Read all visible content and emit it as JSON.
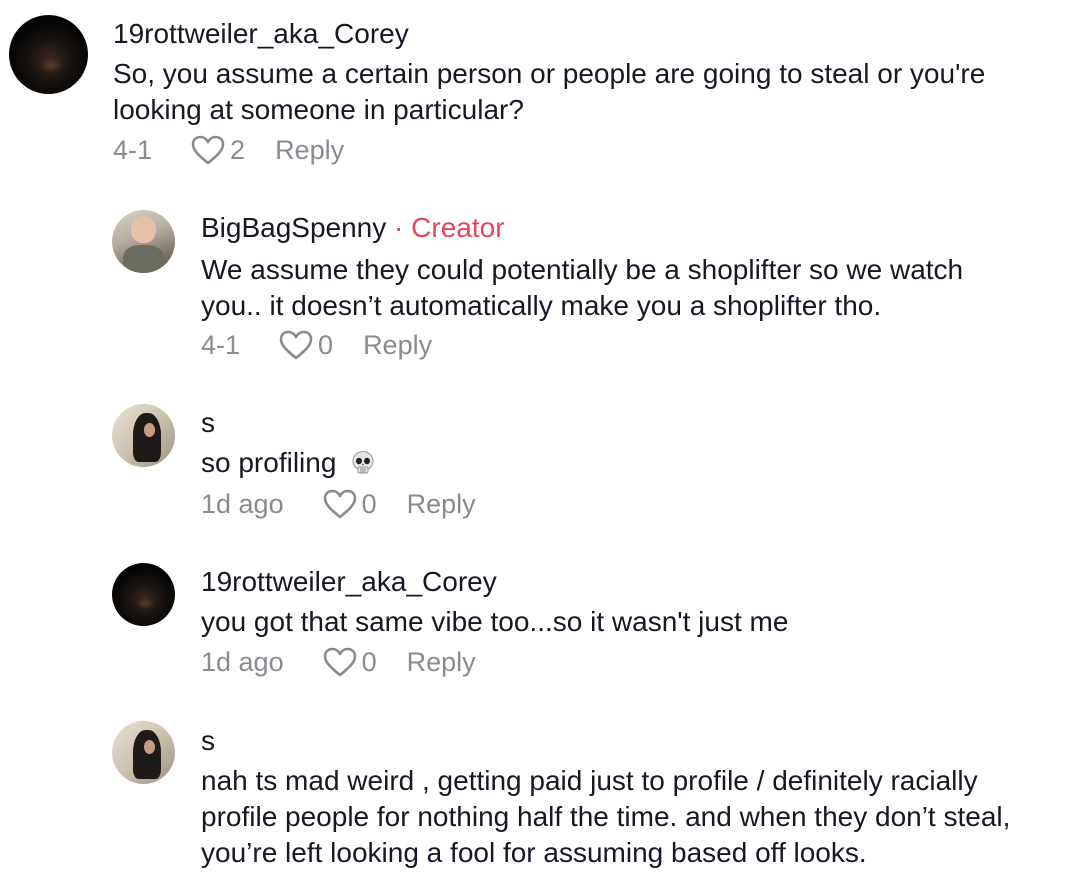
{
  "comments": [
    {
      "username": "19rottweiler_aka_Corey",
      "text": "So, you assume a certain person or people are going to steal or you're looking at someone in particular?",
      "date": "4-1",
      "likes": "2",
      "reply_label": "Reply",
      "avatar": "rottweiler-avatar"
    },
    {
      "username": "BigBagSpenny",
      "badge_separator": "·",
      "badge": "Creator",
      "text": "We assume they could potentially be a shoplifter so we watch you.. it doesn’t automatically make you a shoplifter tho.",
      "date": "4-1",
      "likes": "0",
      "reply_label": "Reply",
      "avatar": "creator-avatar"
    },
    {
      "username": "s",
      "text": "so profiling",
      "emoji": "skull-emoji",
      "date": "1d ago",
      "likes": "0",
      "reply_label": "Reply",
      "avatar": "girl-avatar"
    },
    {
      "username": "19rottweiler_aka_Corey",
      "text": "you got that same vibe too...so it wasn't just me",
      "date": "1d ago",
      "likes": "0",
      "reply_label": "Reply",
      "avatar": "rottweiler-avatar"
    },
    {
      "username": "s",
      "text": "nah ts mad weird , getting paid just to profile / definitely racially profile people for nothing half the time. and when they don’t steal, you’re left looking a fool for assuming based off looks.",
      "avatar": "girl-avatar"
    }
  ],
  "colors": {
    "creator_badge": "#e8455d",
    "meta_text": "#8a8b91",
    "primary_text": "#161823"
  }
}
